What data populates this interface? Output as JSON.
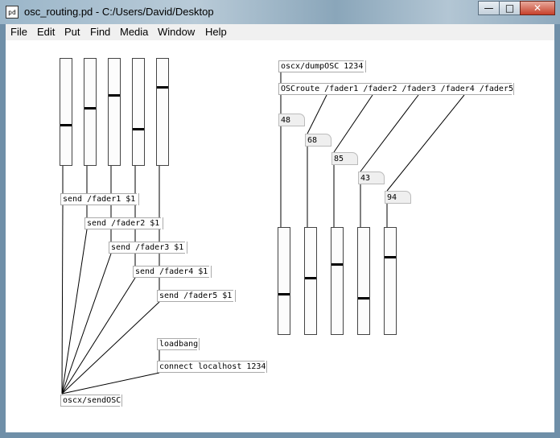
{
  "window": {
    "title": "osc_routing.pd  - C:/Users/David/Desktop",
    "icon_text": "pd"
  },
  "menu": {
    "items": [
      "File",
      "Edit",
      "Put",
      "Find",
      "Media",
      "Window",
      "Help"
    ]
  },
  "send_objects": [
    "send /fader1 $1",
    "send /fader2 $1",
    "send /fader3 $1",
    "send /fader4 $1",
    "send /fader5 $1"
  ],
  "left_faders": {
    "levels": [
      0.62,
      0.46,
      0.34,
      0.66,
      0.26
    ]
  },
  "loadbang": "loadbang",
  "connect": "connect localhost 1234",
  "sendosc": "oscx/sendOSC",
  "dumposc": "oscx/dumpOSC 1234",
  "oscroute": "OSCroute /fader1 /fader2 /fader3 /fader4 /fader5",
  "number_boxes": [
    "48",
    "68",
    "85",
    "43",
    "94"
  ],
  "right_faders": {
    "levels": [
      0.62,
      0.47,
      0.34,
      0.66,
      0.27
    ]
  }
}
